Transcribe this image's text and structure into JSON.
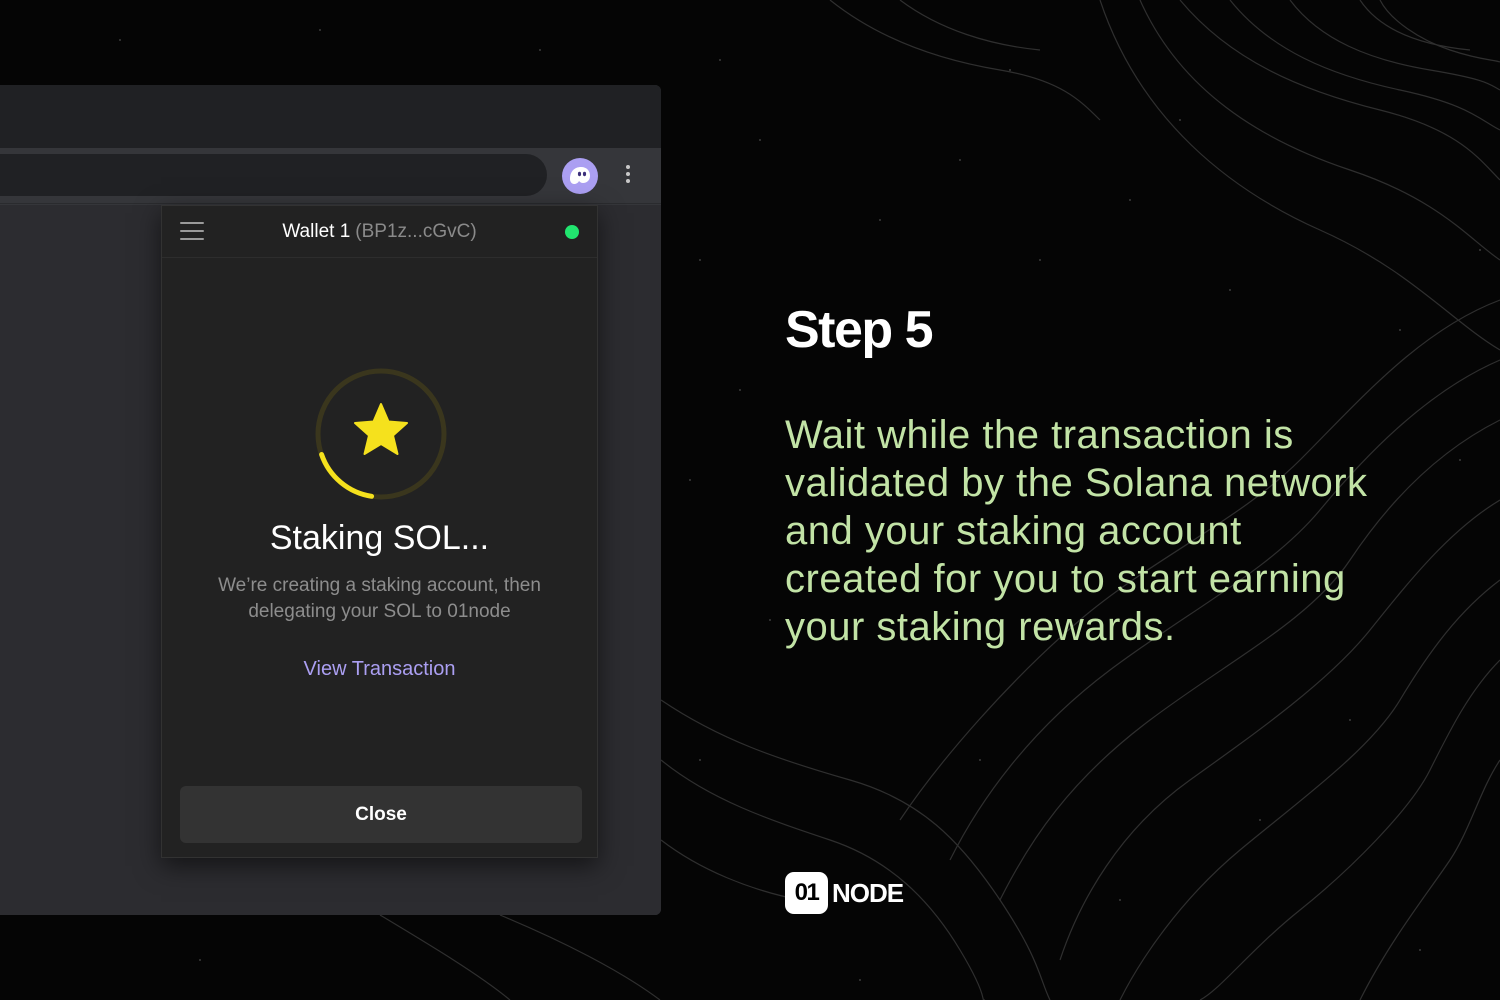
{
  "browser": {
    "extension_icon": "phantom-ghost-icon",
    "menu_icon": "vertical-dots-icon"
  },
  "wallet": {
    "menu_icon": "hamburger-icon",
    "name": "Wallet 1",
    "address": "(BP1z...cGvC)",
    "status_color": "#21e56f"
  },
  "staking": {
    "icon": "star-icon",
    "spinner_accent": "#f5e11d",
    "title": "Staking SOL...",
    "description": "We’re creating a staking account, then delegating your SOL to 01node",
    "view_link": "View Transaction",
    "close_label": "Close"
  },
  "step": {
    "title": "Step 5",
    "description": "Wait while the transaction is validated by the Solana network and your staking account created for you to start earning your staking rewards."
  },
  "logo": {
    "mark": "01",
    "word": "NODE"
  },
  "colors": {
    "background": "#050505",
    "accent_text": "#c2e3a6",
    "link": "#ab9ff2"
  }
}
